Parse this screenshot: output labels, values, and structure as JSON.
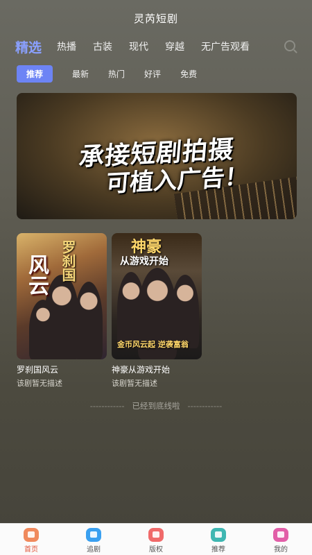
{
  "header": {
    "title": "灵芮短剧"
  },
  "main_tabs": [
    {
      "label": "精选"
    },
    {
      "label": "热播"
    },
    {
      "label": "古装"
    },
    {
      "label": "现代"
    },
    {
      "label": "穿越"
    },
    {
      "label": "无广告观看"
    }
  ],
  "sub_tabs": [
    {
      "label": "推荐"
    },
    {
      "label": "最新"
    },
    {
      "label": "热门"
    },
    {
      "label": "好评"
    },
    {
      "label": "免费"
    }
  ],
  "banner": {
    "line1": "承接短剧拍摄",
    "line2": "可植入广告！"
  },
  "cards": [
    {
      "title": "罗刹国风云",
      "description": "该剧暂无描述",
      "poster_text_top": "罗刹国",
      "poster_text_big": "风云"
    },
    {
      "title": "神豪从游戏开始",
      "description": "该剧暂无描述",
      "poster_text_top": "神豪",
      "poster_text_sub": "从游戏开始",
      "poster_text_foot": "金币风云起 逆袭富翁"
    }
  ],
  "end_text": "已经到底线啦",
  "end_dashes": "------------",
  "bottom_nav": [
    {
      "label": "首页",
      "icon": "home-play-icon",
      "color": "#f08a5d"
    },
    {
      "label": "追剧",
      "icon": "heart-icon",
      "color": "#3aa0f0"
    },
    {
      "label": "版权",
      "icon": "copyright-icon",
      "color": "#f06a6a"
    },
    {
      "label": "推荐",
      "icon": "tag-icon",
      "color": "#3fb7b2"
    },
    {
      "label": "我的",
      "icon": "house-icon",
      "color": "#e25fa8"
    }
  ],
  "colors": {
    "accent": "#8aa0ff",
    "subtab_active_bg": "#6d84f5",
    "nav_active": "#e0543a"
  }
}
